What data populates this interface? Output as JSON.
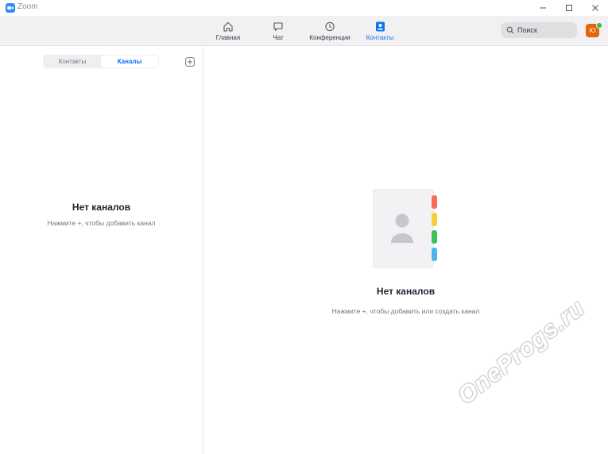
{
  "window": {
    "title": "Zoom",
    "controls": [
      "minimize",
      "maximize",
      "close"
    ]
  },
  "nav": {
    "items": [
      {
        "label": "Главная",
        "icon": "home-icon",
        "active": false
      },
      {
        "label": "Чат",
        "icon": "chat-icon",
        "active": false
      },
      {
        "label": "Конференции",
        "icon": "clock-icon",
        "active": false
      },
      {
        "label": "Контакты",
        "icon": "contacts-icon",
        "active": true
      }
    ],
    "search_label": "Поиск",
    "avatar_initial": "Ю"
  },
  "left": {
    "tabs": [
      {
        "label": "Контакты",
        "active": false
      },
      {
        "label": "Каналы",
        "active": true
      }
    ],
    "empty_title": "Нет каналов",
    "empty_subtitle": "Нажмите +, чтобы добавить канал"
  },
  "right": {
    "empty_title": "Нет каналов",
    "empty_subtitle": "Нажмите +, чтобы добавить или создать канал"
  },
  "watermark": "OneProgs.ru",
  "colors": {
    "accent": "#0e72ed",
    "avatar": "#e8630a",
    "status_online": "#26c245",
    "tab_red": "#f26d5b",
    "tab_yellow": "#f7d038",
    "tab_green": "#3cc259",
    "tab_blue": "#4db4f0"
  }
}
